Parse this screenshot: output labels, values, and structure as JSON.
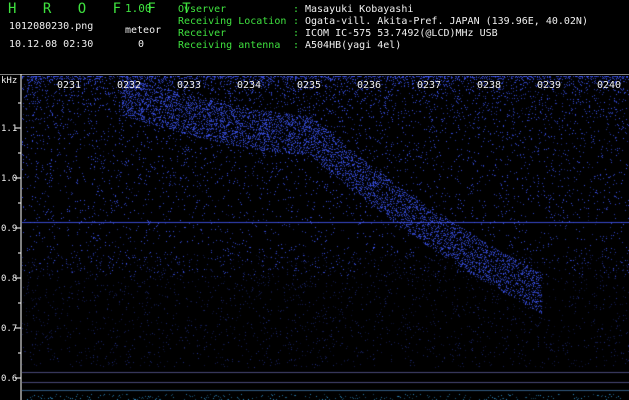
{
  "header": {
    "app_title": "H R O F F T",
    "version": "1.00",
    "filename": "1012080230.png",
    "meteor_label": "meteor",
    "datetime": "10.12.08 02:30",
    "meteor_count": "0"
  },
  "info": [
    {
      "key": "Ovserver",
      "value": "Masayuki Kobayashi"
    },
    {
      "key": "Receiving Location",
      "value": "Ogata-vill. Akita-Pref. JAPAN (139.96E, 40.02N)"
    },
    {
      "key": "Receiver",
      "value": "ICOM IC-575 53.7492(@LCD)MHz USB"
    },
    {
      "key": "Receiving antenna",
      "value": "A504HB(yagi 4el)"
    }
  ],
  "y_axis": {
    "unit": "kHz",
    "ticks": [
      "1.1",
      "1.0",
      "0.9",
      "0.8",
      "0.7",
      "0.6"
    ]
  },
  "x_axis": {
    "ticks": [
      "0231",
      "0232",
      "0233",
      "0234",
      "0235",
      "0236",
      "0237",
      "0238",
      "0239",
      "0240"
    ]
  },
  "colors": {
    "text_green": "#3fe23f",
    "text_white": "#f0f0f0",
    "signal_blue": "#3a4cff",
    "background": "#000000"
  }
}
